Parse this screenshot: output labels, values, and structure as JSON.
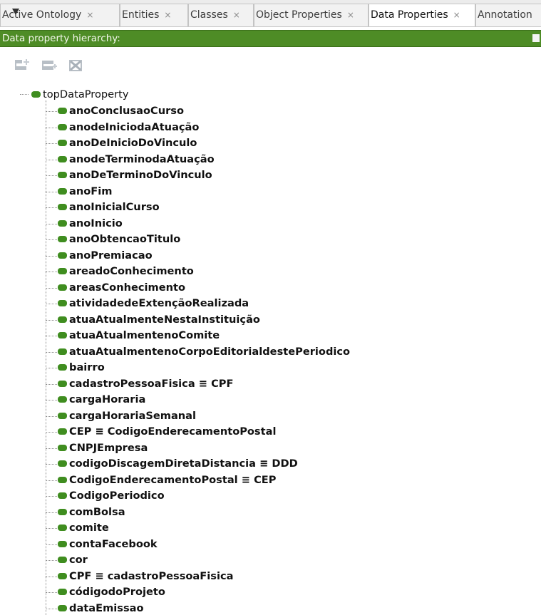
{
  "tabs": [
    {
      "label": "Active Ontology",
      "close": "×",
      "active": false
    },
    {
      "label": "Entities",
      "close": "×",
      "active": false
    },
    {
      "label": "Classes",
      "close": "×",
      "active": false
    },
    {
      "label": "Object Properties",
      "close": "×",
      "active": false
    },
    {
      "label": "Data Properties",
      "close": "×",
      "active": true
    },
    {
      "label": "Annotation",
      "close": "",
      "active": false
    }
  ],
  "view": {
    "title": "Data property hierarchy:"
  },
  "toolbar": {
    "add_subproperty_icon": "add-subproperty-icon",
    "add_sibling_icon": "add-sibling-icon",
    "delete_icon": "delete-property-icon"
  },
  "tree": {
    "root": "topDataProperty",
    "items": [
      "anoConclusaoCurso",
      "anodeIniciodaAtuação",
      "anoDeInicioDoVinculo",
      "anodeTerminodaAtuação",
      "anoDeTerminoDoVinculo",
      "anoFim",
      "anoInicialCurso",
      "anoInicio",
      "anoObtencaoTitulo",
      "anoPremiacao",
      "areadoConhecimento",
      "areasConhecimento",
      "atividadedeExtençãoRealizada",
      "atuaAtualmenteNestaInstituição",
      "atuaAtualmentenoComite",
      "atuaAtualmentenoCorpoEditorialdestePeriodico",
      "bairro",
      "cadastroPessoaFisica ≡ CPF",
      "cargaHoraria",
      "cargaHorariaSemanal",
      "CEP ≡ CodigoEnderecamentoPostal",
      "CNPJEmpresa",
      "codigoDiscagemDiretaDistancia ≡ DDD",
      "CodigoEnderecamentoPostal ≡ CEP",
      "CodigoPeriodico",
      "comBolsa",
      "comite",
      "contaFacebook",
      "cor",
      "CPF ≡ cadastroPessoaFisica",
      "códigodoProjeto",
      "dataEmissao"
    ]
  },
  "colors": {
    "header_green": "#4e8c26",
    "bullet_green": "#3f8d1f"
  }
}
